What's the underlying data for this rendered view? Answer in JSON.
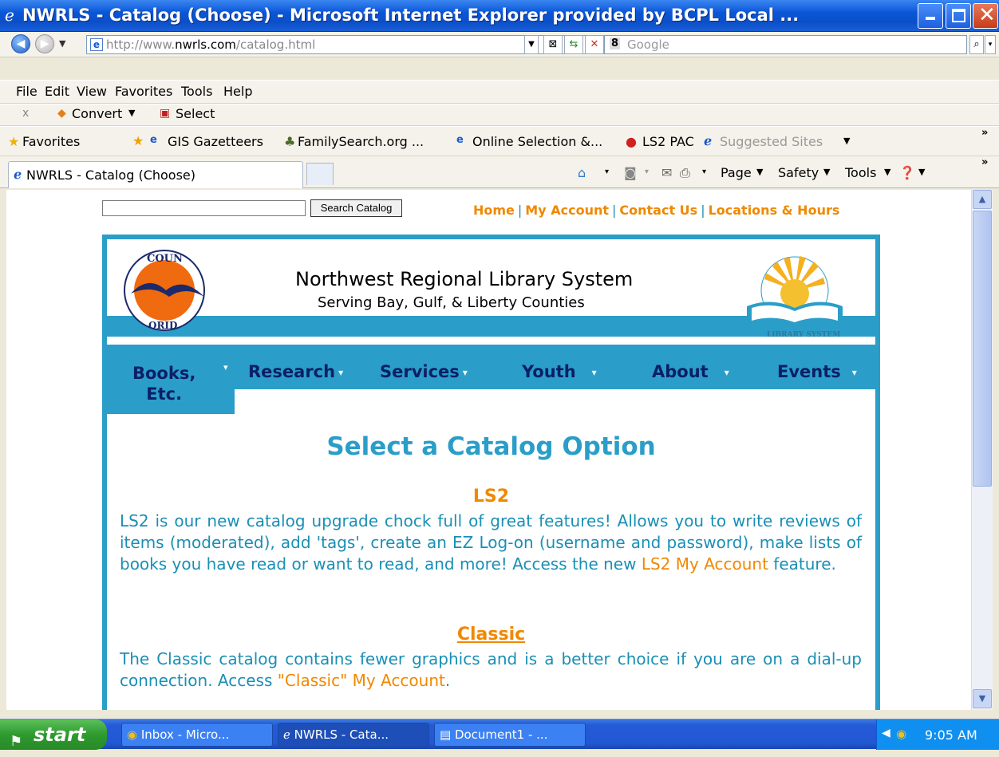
{
  "window": {
    "title": "NWRLS - Catalog (Choose) - Microsoft Internet Explorer provided by BCPL Local ..."
  },
  "address_bar": {
    "url_prefix": "http://www.",
    "url_domain": "nwrls.com",
    "url_suffix": "/catalog.html"
  },
  "search_provider": {
    "placeholder": "Google"
  },
  "menu": [
    "File",
    "Edit",
    "View",
    "Favorites",
    "Tools",
    "Help"
  ],
  "convert_bar": {
    "close": "x",
    "convert": "Convert",
    "select": "Select"
  },
  "favorites_bar": {
    "favorites": "Favorites",
    "items": [
      "GIS Gazetteers",
      "FamilySearch.org ...",
      "Online Selection &...",
      "LS2 PAC",
      "Suggested Sites"
    ]
  },
  "tab": {
    "label": "NWRLS - Catalog (Choose)"
  },
  "command_bar": {
    "page": "Page",
    "safety": "Safety",
    "tools": "Tools"
  },
  "page": {
    "search_button": "Search Catalog",
    "top_links": [
      "Home",
      "My Account",
      "Contact Us",
      "Locations & Hours"
    ],
    "library_name": "Northwest Regional Library System",
    "library_subtitle": "Serving Bay, Gulf, & Liberty Counties",
    "nav": [
      "Books,",
      "Etc.",
      "Research",
      "Services",
      "Youth",
      "About",
      "Events"
    ],
    "heading": "Select a Catalog Option",
    "ls2": {
      "title": "LS2",
      "text": "LS2 is our new catalog upgrade chock full of great features! Allows you to write reviews of items (moderated), add 'tags', create an EZ Log-on (username and password), make lists of books you have read or want to read, and more! Access the new ",
      "link": "LS2 My Account",
      "tail": " feature."
    },
    "classic": {
      "title": "Classic",
      "text": "The Classic catalog contains fewer graphics and is a better choice if you are on a dial-up connection.  Access ",
      "link": "\"Classic\" My Account",
      "tail": "."
    }
  },
  "taskbar": {
    "start": "start",
    "buttons": [
      "Inbox - Micro...",
      "NWRLS - Cata...",
      "Document1 - ..."
    ],
    "clock": "9:05 AM"
  },
  "colors": {
    "teal": "#2a9ec8",
    "orange": "#f08800",
    "navy": "#0b1f66"
  }
}
